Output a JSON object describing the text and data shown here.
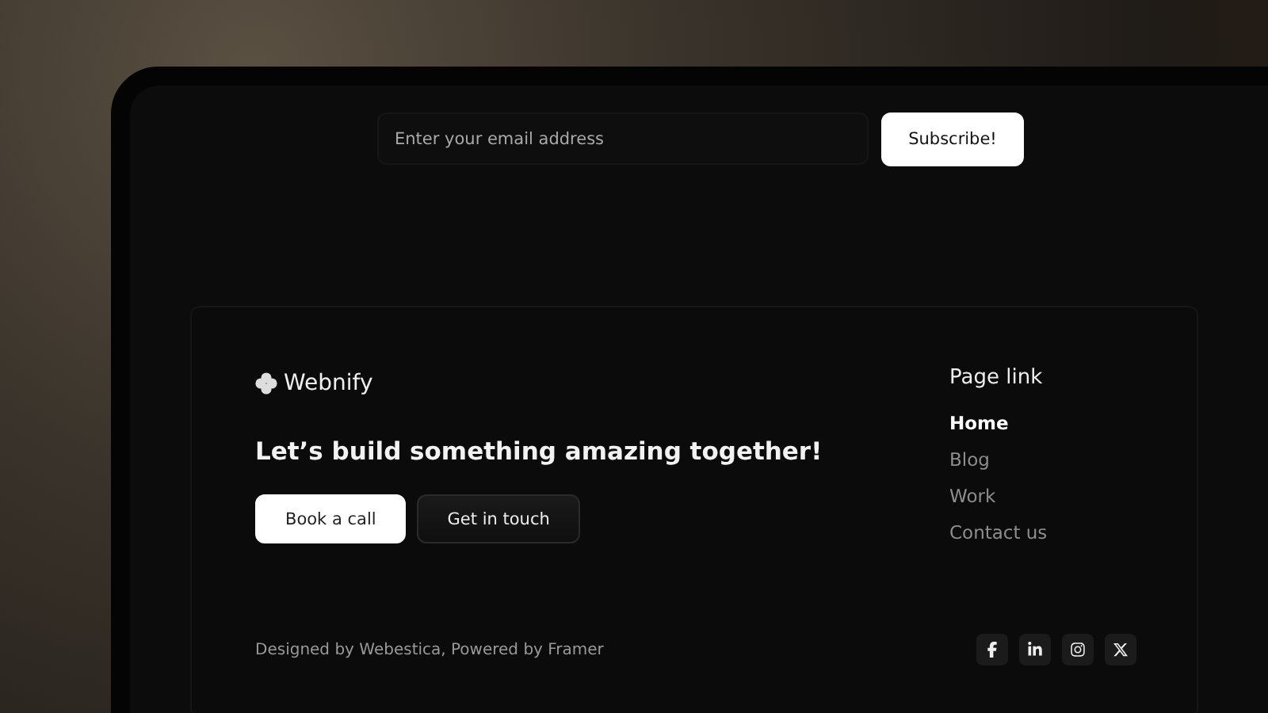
{
  "newsletter": {
    "placeholder": "Enter your email address",
    "button": "Subscribe!"
  },
  "footer": {
    "brand": "Webnify",
    "headline": "Let’s build something amazing together!",
    "buttons": [
      {
        "label": "Book a call",
        "kind": "primary"
      },
      {
        "label": "Get in touch",
        "kind": "secondary"
      }
    ],
    "links_title": "Page link",
    "links": [
      {
        "label": "Home",
        "selected": true
      },
      {
        "label": "Blog",
        "selected": false
      },
      {
        "label": "Work",
        "selected": false
      },
      {
        "label": "Contact us",
        "selected": false
      }
    ],
    "credit": "Designed by Webestica, Powered by Framer",
    "social": [
      {
        "kind": "facebook"
      },
      {
        "kind": "linkedin"
      },
      {
        "kind": "instagram"
      },
      {
        "kind": "x"
      }
    ]
  }
}
